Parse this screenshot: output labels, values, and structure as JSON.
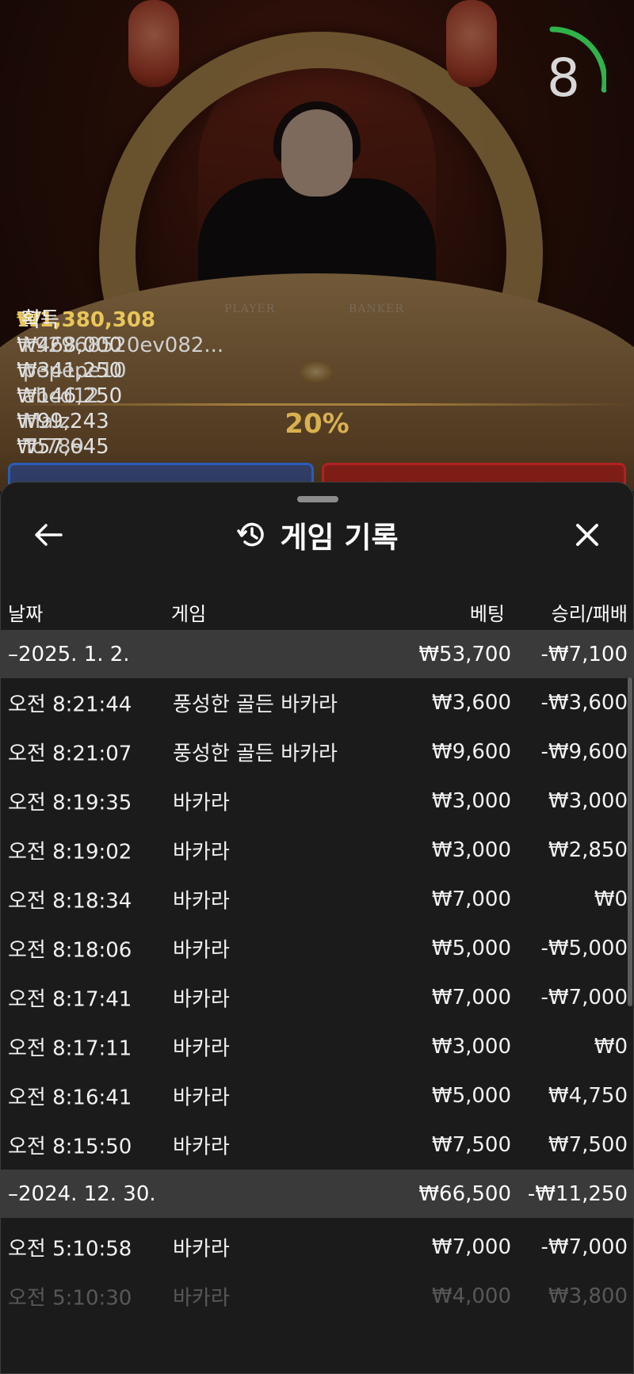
{
  "video": {
    "countdown": "8",
    "countdown_progress": 0.55,
    "table_labels": [
      "PLAYER",
      "BANKER"
    ],
    "winners": {
      "count": "17",
      "total": "₩1,380,308",
      "suffix": "획득",
      "rows": [
        {
          "amount": "₩468,000",
          "name": "k92968520ev082..."
        },
        {
          "amount": "₩341,250",
          "name": "pepepe10"
        },
        {
          "amount": "₩146,250",
          "name": "abcd12"
        },
        {
          "amount": "₩99,243",
          "name": "Malz"
        },
        {
          "amount": "₩57,645",
          "name": "To789"
        }
      ]
    },
    "percent": "20%"
  },
  "sheet": {
    "title": "게임 기록",
    "icons": {
      "back": "arrow-left-icon",
      "history": "history-icon",
      "close": "close-icon"
    },
    "columns": {
      "date": "날짜",
      "game": "게임",
      "bet": "베팅",
      "win": "승리/패배"
    },
    "groups": [
      {
        "date": "–2025. 1. 2.",
        "bet": "₩53,700",
        "win": "-₩7,100",
        "rows": [
          {
            "time": "오전 8:21:44",
            "game": "풍성한 골든 바카라",
            "bet": "₩3,600",
            "win": "-₩3,600"
          },
          {
            "time": "오전 8:21:07",
            "game": "풍성한 골든 바카라",
            "bet": "₩9,600",
            "win": "-₩9,600"
          },
          {
            "time": "오전 8:19:35",
            "game": "바카라",
            "bet": "₩3,000",
            "win": "₩3,000"
          },
          {
            "time": "오전 8:19:02",
            "game": "바카라",
            "bet": "₩3,000",
            "win": "₩2,850"
          },
          {
            "time": "오전 8:18:34",
            "game": "바카라",
            "bet": "₩7,000",
            "win": "₩0"
          },
          {
            "time": "오전 8:18:06",
            "game": "바카라",
            "bet": "₩5,000",
            "win": "-₩5,000"
          },
          {
            "time": "오전 8:17:41",
            "game": "바카라",
            "bet": "₩7,000",
            "win": "-₩7,000"
          },
          {
            "time": "오전 8:17:11",
            "game": "바카라",
            "bet": "₩3,000",
            "win": "₩0"
          },
          {
            "time": "오전 8:16:41",
            "game": "바카라",
            "bet": "₩5,000",
            "win": "₩4,750"
          },
          {
            "time": "오전 8:15:50",
            "game": "바카라",
            "bet": "₩7,500",
            "win": "₩7,500"
          }
        ]
      },
      {
        "date": "–2024. 12. 30.",
        "bet": "₩66,500",
        "win": "-₩11,250",
        "rows": [
          {
            "time": "오전 5:10:58",
            "game": "바카라",
            "bet": "₩7,000",
            "win": "-₩7,000"
          },
          {
            "time": "오전 5:10:30",
            "game": "바카라",
            "bet": "₩4,000",
            "win": "₩3,800"
          }
        ]
      }
    ]
  }
}
